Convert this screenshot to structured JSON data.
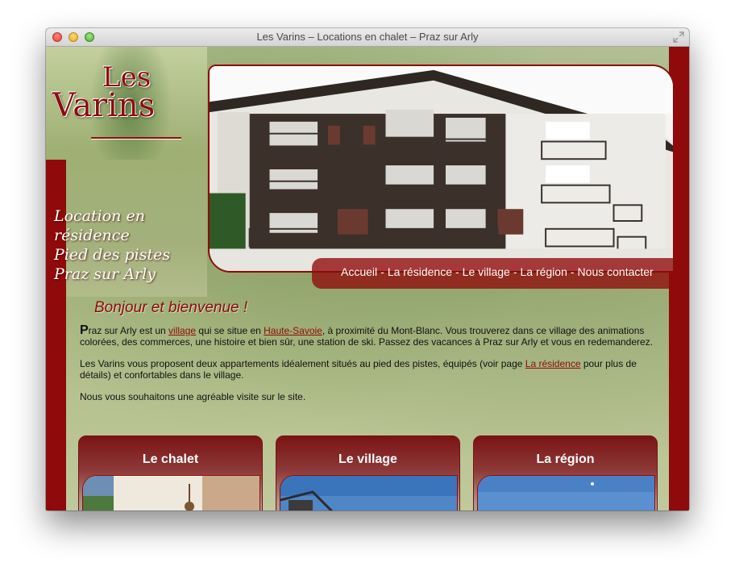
{
  "window": {
    "title": "Les Varins – Locations en chalet – Praz sur Arly"
  },
  "logo": {
    "les": "Les",
    "varins": "Varins"
  },
  "tagline": [
    "Location en",
    "résidence",
    "Pied des pistes",
    "Praz sur Arly"
  ],
  "nav": {
    "items": [
      "Accueil",
      "La résidence",
      "Le village",
      "La région",
      "Nous contacter"
    ],
    "separator": "-"
  },
  "welcome": "Bonjour et bienvenue !",
  "paragraph1": {
    "dropcap": "P",
    "part1": "raz sur Arly est un ",
    "link1": "village",
    "part2": " qui se situe en ",
    "link2": "Haute-Savoie",
    "part3": ", à proximité du Mont-Blanc. Vous trouverez dans ce village des animations colorées, des commerces, une histoire et bien sûr, une station de ski. Passez des vacances à Praz sur Arly et vous en redemanderez."
  },
  "paragraph2": {
    "part1": "Les Varins vous proposent deux appartements idéalement situés au pied des pistes, équipés (voir page ",
    "link": "La résidence",
    "part2": " pour plus de détails) et confortables dans le village."
  },
  "paragraph3": "Nous vous souhaitons une agréable visite sur le site.",
  "cards": [
    {
      "title": "Le chalet"
    },
    {
      "title": "Le village"
    },
    {
      "title": "La région"
    }
  ],
  "colors": {
    "brand": "#8f0a0a",
    "meadow": "#b4c08e"
  }
}
